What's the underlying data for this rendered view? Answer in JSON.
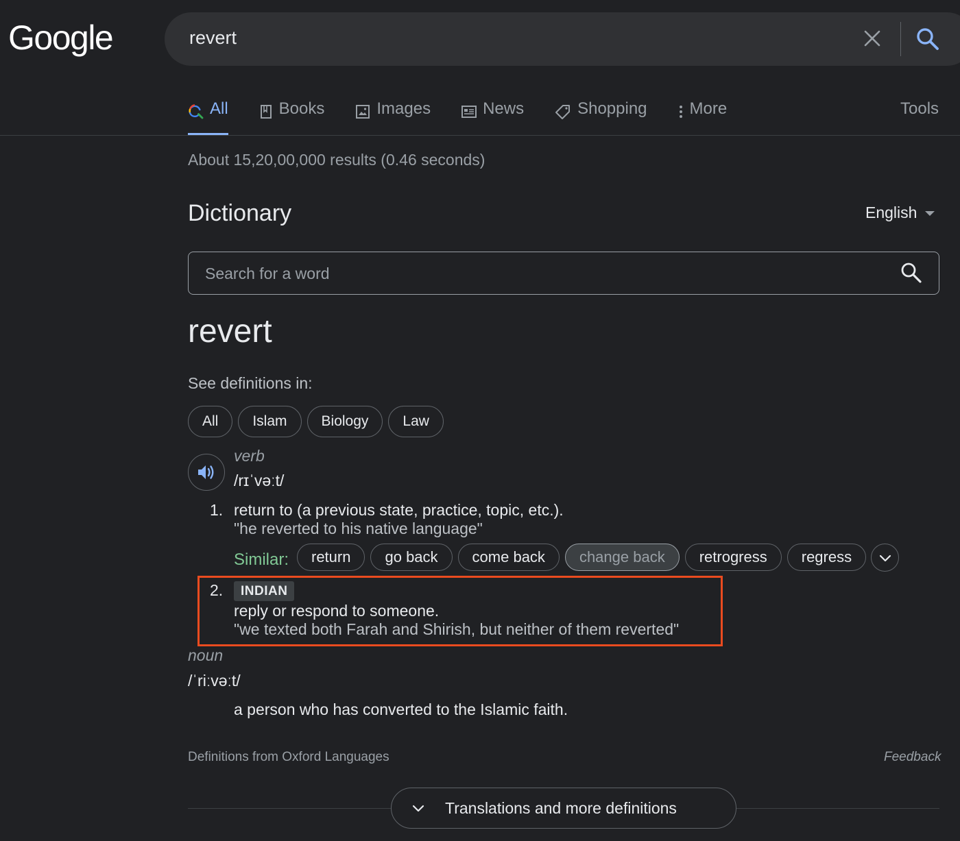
{
  "header": {
    "logo_text": "Google",
    "query": "revert"
  },
  "tabs": [
    {
      "label": "All",
      "icon": "search-icon",
      "active": true
    },
    {
      "label": "Books",
      "icon": "book-icon",
      "active": false
    },
    {
      "label": "Images",
      "icon": "image-icon",
      "active": false
    },
    {
      "label": "News",
      "icon": "news-icon",
      "active": false
    },
    {
      "label": "Shopping",
      "icon": "tag-icon",
      "active": false
    },
    {
      "label": "More",
      "icon": "dots-vertical-icon",
      "active": false
    }
  ],
  "tools_label": "Tools",
  "result_stats": "About 15,20,00,000 results (0.46 seconds)",
  "dictionary": {
    "title": "Dictionary",
    "language": "English",
    "search_placeholder": "Search for a word",
    "headword": "revert",
    "see_definitions_label": "See definitions in:",
    "domains": [
      "All",
      "Islam",
      "Biology",
      "Law"
    ],
    "verb": {
      "pos": "verb",
      "phonetic": "/rɪˈvəːt/",
      "sense1": {
        "number": "1.",
        "definition": "return to (a previous state, practice, topic, etc.).",
        "example": "\"he reverted to his native language\"",
        "similar_label": "Similar:",
        "similar": [
          "return",
          "go back",
          "come back",
          "change back",
          "retrogress",
          "regress"
        ],
        "selected_similar": "change back"
      },
      "sense2": {
        "number": "2.",
        "region": "INDIAN",
        "definition": "reply or respond to someone.",
        "example": "\"we texted both Farah and Shirish, but neither of them reverted\""
      }
    },
    "noun": {
      "pos": "noun",
      "phonetic": "/ˈriːvəːt/",
      "definition": "a person who has converted to the Islamic faith."
    },
    "source": "Definitions from Oxford Languages",
    "feedback": "Feedback",
    "more_button": "Translations and more definitions"
  },
  "colors": {
    "background": "#202124",
    "accent_blue": "#8ab4f8",
    "similar_green": "#81c995",
    "highlight_red": "#ea4b1f"
  }
}
